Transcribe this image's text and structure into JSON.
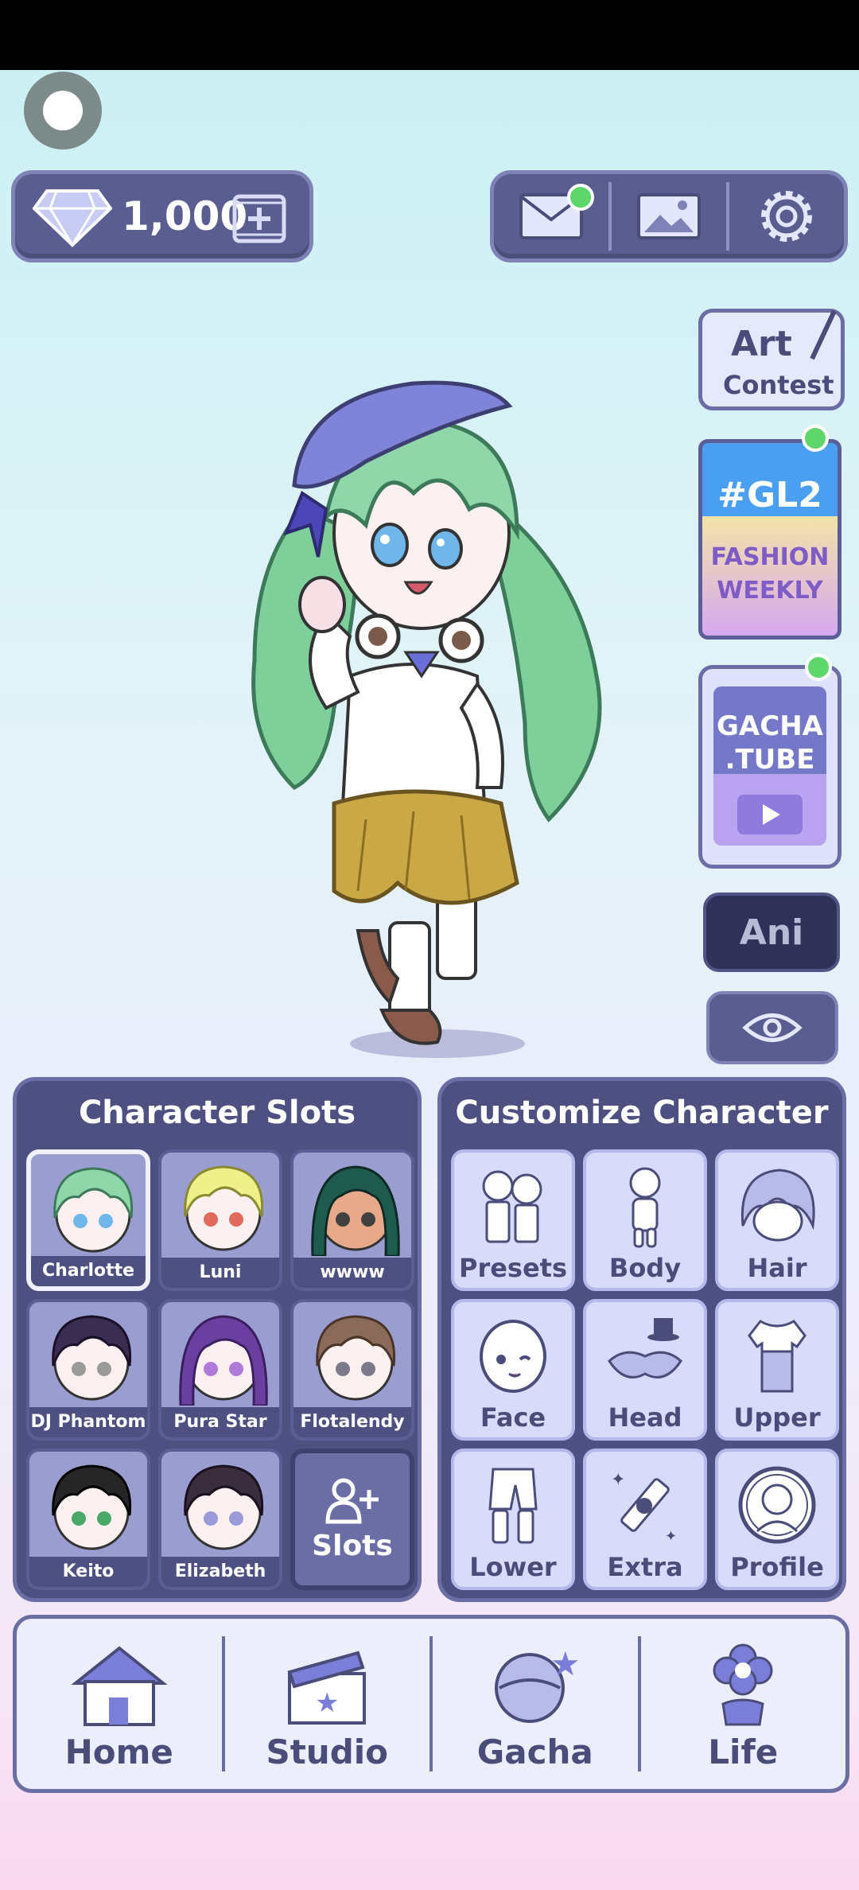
{
  "currency": {
    "amount": "1,000"
  },
  "top_icons": [
    {
      "name": "mail-icon",
      "badge": true
    },
    {
      "name": "gallery-icon",
      "badge": false
    },
    {
      "name": "settings-icon",
      "badge": false
    }
  ],
  "side": {
    "art_contest": {
      "line1": "Art",
      "line2": "Contest"
    },
    "gl2": {
      "title": "#GL2",
      "line1": "FASHION",
      "line2": "WEEKLY"
    },
    "gacha_tube": {
      "line1": "GACHA",
      "line2": ".TUBE"
    },
    "ani_label": "Ani"
  },
  "character_slots": {
    "title": "Character Slots",
    "slots": [
      {
        "name": "Charlotte",
        "hair": "#8fd6a8",
        "eyes": "#6fb6ea",
        "selected": true
      },
      {
        "name": "Luni",
        "hair": "#eef08a",
        "eyes": "#e06a5c"
      },
      {
        "name": "wwww",
        "hair": "#1f5a4e",
        "eyes": "#404040"
      },
      {
        "name": "DJ Phantom",
        "hair": "#3a2d52",
        "eyes": "#9a9a9a"
      },
      {
        "name": "Pura Star",
        "hair": "#6a3fa0",
        "eyes": "#b07ad8"
      },
      {
        "name": "Flotalendy",
        "hair": "#8a6a58",
        "eyes": "#7a7a8a"
      },
      {
        "name": "Keito",
        "hair": "#262626",
        "eyes": "#4aa86a"
      },
      {
        "name": "Elizabeth",
        "hair": "#3a2e3e",
        "eyes": "#9a9ad8"
      }
    ],
    "add_label": "Slots"
  },
  "customize": {
    "title": "Customize Character",
    "items": [
      {
        "label": "Presets",
        "icon": "presets-icon"
      },
      {
        "label": "Body",
        "icon": "body-icon"
      },
      {
        "label": "Hair",
        "icon": "hair-icon"
      },
      {
        "label": "Face",
        "icon": "face-icon"
      },
      {
        "label": "Head",
        "icon": "head-icon"
      },
      {
        "label": "Upper",
        "icon": "upper-icon"
      },
      {
        "label": "Lower",
        "icon": "lower-icon"
      },
      {
        "label": "Extra",
        "icon": "extra-icon"
      },
      {
        "label": "Profile",
        "icon": "profile-icon"
      }
    ]
  },
  "nav": [
    {
      "label": "Home",
      "icon": "house-icon"
    },
    {
      "label": "Studio",
      "icon": "clapperboard-icon"
    },
    {
      "label": "Gacha",
      "icon": "gacha-orb-icon"
    },
    {
      "label": "Life",
      "icon": "flower-icon"
    }
  ],
  "colors": {
    "panel": "#5a5d8f",
    "accent": "#7e82b6",
    "badge": "#5fd66b"
  }
}
